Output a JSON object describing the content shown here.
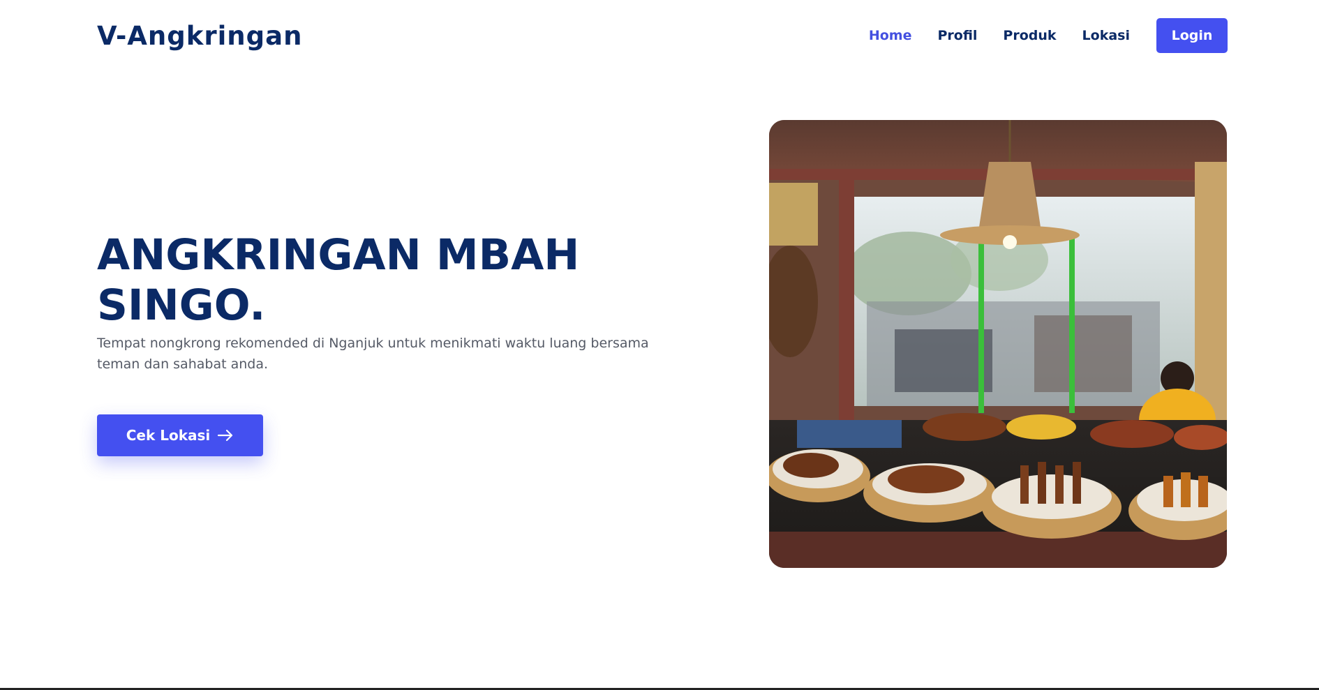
{
  "brand": "V-Angkringan",
  "nav": {
    "items": [
      {
        "label": "Home",
        "active": true
      },
      {
        "label": "Profil",
        "active": false
      },
      {
        "label": "Produk",
        "active": false
      },
      {
        "label": "Lokasi",
        "active": false
      }
    ],
    "login_label": "Login"
  },
  "hero": {
    "title": "ANGKRINGAN MBAH SINGO.",
    "subtitle": "Tempat nongkrong rekomended di Nganjuk untuk menikmati waktu luang bersama teman dan sahabat anda.",
    "cta_label": "Cek Lokasi",
    "cta_icon": "arrow-right-icon"
  },
  "colors": {
    "primary": "#4450f0",
    "navy": "#0b2a66",
    "active_link": "#4450e0",
    "body_text": "#555a66"
  }
}
